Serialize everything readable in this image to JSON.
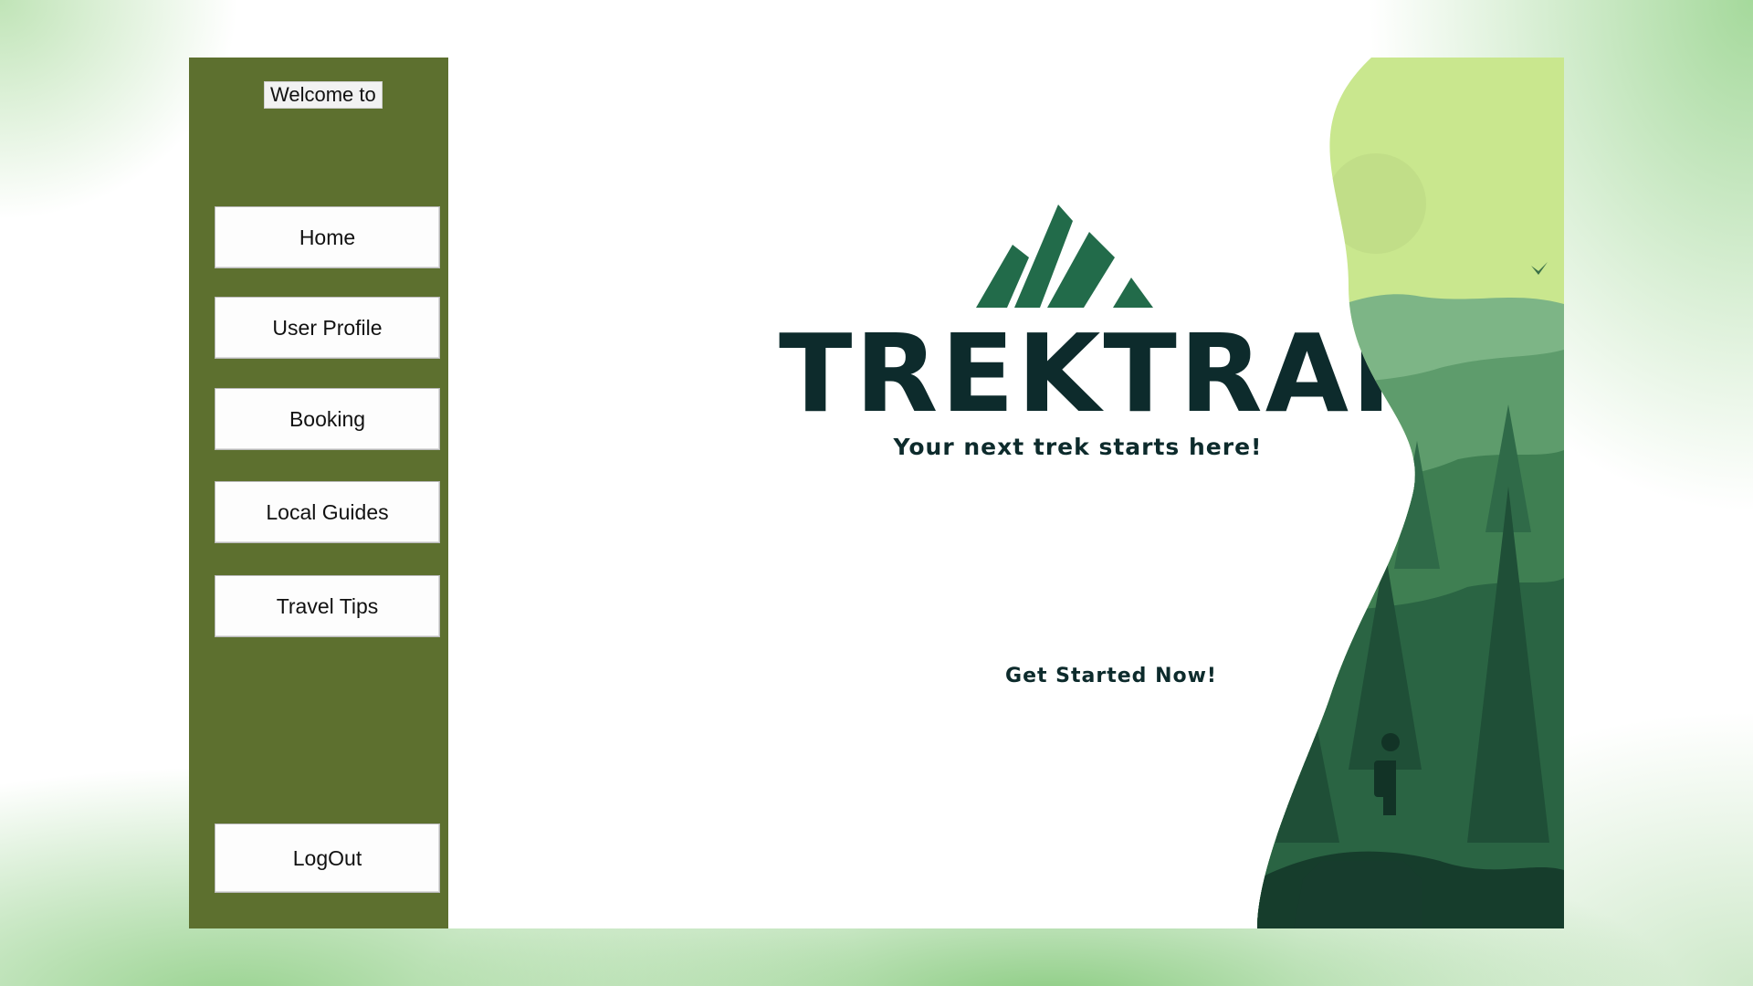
{
  "sidebar": {
    "welcome_label": "Welcome to",
    "nav_items": [
      {
        "label": "Home"
      },
      {
        "label": "User Profile"
      },
      {
        "label": "Booking"
      },
      {
        "label": "Local Guides"
      },
      {
        "label": "Travel Tips"
      }
    ],
    "logout_label": "LogOut"
  },
  "main": {
    "brand_title": "TREKTRAIL",
    "tagline": "Your next trek starts here!",
    "cta_label": "Get Started Now!"
  },
  "icons": {
    "logo": "mountain-logo-icon",
    "hero": "forest-landscape-illustration"
  },
  "colors": {
    "sidebar_bg": "#5d702f",
    "brand_dark": "#0d2b2c",
    "logo_green": "#226b4a",
    "sky": "#c9e78e"
  }
}
